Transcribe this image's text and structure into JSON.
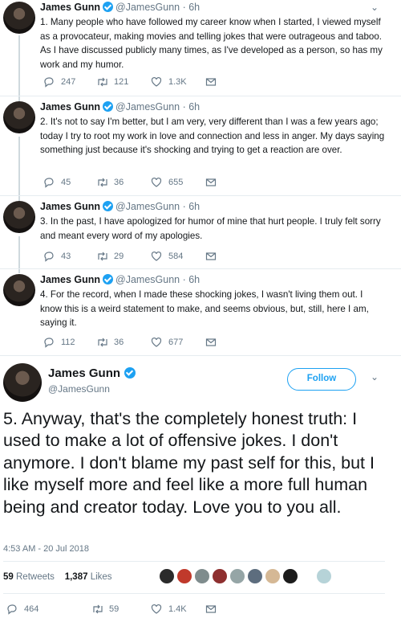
{
  "tweets": [
    {
      "name": "James Gunn",
      "handle": "@JamesGunn · 6h",
      "text": "1. Many people who have followed my career know when I started, I viewed myself as a provocateur, making movies and telling jokes that were outrageous and taboo. As I have discussed publicly many times, as I've developed as a person, so has my work and my humor.",
      "replies": "247",
      "retweets": "121",
      "likes": "1.3K"
    },
    {
      "name": "James Gunn",
      "handle": "@JamesGunn · 6h",
      "text": "2. It's not to say I'm better, but I am very, very different than I was a few years ago; today I try to root my work in love and connection and less in anger. My days saying something just because it's shocking and trying to get a reaction are over.",
      "replies": "45",
      "retweets": "36",
      "likes": "655"
    },
    {
      "name": "James Gunn",
      "handle": "@JamesGunn · 6h",
      "text": "3. In the past, I have apologized for humor of mine that hurt people. I truly felt sorry and meant every word of my apologies.",
      "replies": "43",
      "retweets": "29",
      "likes": "584"
    },
    {
      "name": "James Gunn",
      "handle": "@JamesGunn · 6h",
      "text": "4. For the record, when I made these shocking jokes, I wasn't living them out. I know this is a weird statement to make, and seems obvious, but, still, here I am, saying it.",
      "replies": "112",
      "retweets": "36",
      "likes": "677"
    }
  ],
  "main_tweet": {
    "name": "James Gunn",
    "handle": "@JamesGunn",
    "follow_label": "Follow",
    "text": "5. Anyway, that's the completely honest truth: I used to make a lot of offensive jokes. I don't anymore. I don't blame my past self for this, but I like myself more and feel like a more full human being and creator today.  Love you to you all.",
    "timestamp": "4:53 AM - 20 Jul 2018",
    "retweets_count": "59",
    "retweets_label": "Retweets",
    "likes_count": "1,387",
    "likes_label": "Likes",
    "replies": "464",
    "retweets": "59",
    "likes": "1.4K"
  },
  "colors": {
    "accent": "#1da1f2",
    "muted": "#657786",
    "text": "#14171a"
  },
  "icons": [
    "reply-icon",
    "retweet-icon",
    "like-icon",
    "message-icon",
    "verified-badge-icon",
    "chevron-down-icon"
  ]
}
